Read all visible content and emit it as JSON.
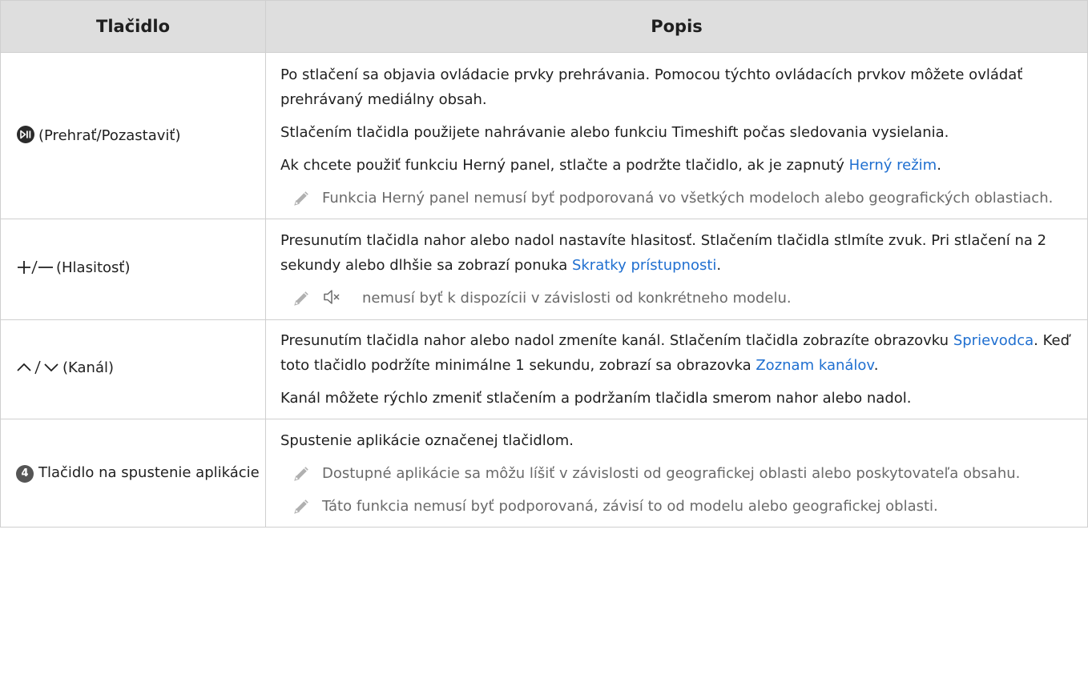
{
  "header": {
    "col_button": "Tlačidlo",
    "col_description": "Popis"
  },
  "rows": [
    {
      "button_label": "(Prehrať/Pozastaviť)",
      "icon": "play-pause-icon",
      "p1": "Po stlačení sa objavia ovládacie prvky prehrávania. Pomocou týchto ovládacích prvkov môžete ovládať prehrávaný mediálny obsah.",
      "p2": "Stlačením tlačidla použijete nahrávanie alebo funkciu Timeshift počas sledovania vysielania.",
      "p3_before": "Ak chcete použiť funkciu Herný panel, stlačte a podržte tlačidlo, ak je zapnutý ",
      "p3_link": "Herný režim",
      "p3_after": ".",
      "note": "Funkcia Herný panel nemusí byť podporovaná vo všetkých modeloch alebo geografických oblastiach."
    },
    {
      "button_label": "(Hlasitosť)",
      "icon": "plus-minus-icon",
      "p1_before": "Presunutím tlačidla nahor alebo nadol nastavíte hlasitosť. Stlačením tlačidla stlmíte zvuk. Pri stlačení na 2 sekundy alebo dlhšie sa zobrazí ponuka ",
      "p1_link": "Skratky prístupnosti",
      "p1_after": ".",
      "note_icon": "mute-icon",
      "note": "nemusí byť k dispozícii v závislosti od konkrétneho modelu."
    },
    {
      "button_label": "(Kanál)",
      "icon": "channel-up-down-icon",
      "p1_part1": "Presunutím tlačidla nahor alebo nadol zmeníte kanál. Stlačením tlačidla zobrazíte obrazovku ",
      "p1_link1": "Sprievodca",
      "p1_part2": ". Keď toto tlačidlo podržíte minimálne 1 sekundu, zobrazí sa obrazovka ",
      "p1_link2": "Zoznam kanálov",
      "p1_part3": ".",
      "p2": "Kanál môžete rýchlo zmeniť stlačením a podržaním tlačidla smerom nahor alebo nadol."
    },
    {
      "icon_number": "4",
      "button_label": "Tlačidlo na spustenie aplikácie",
      "p1": "Spustenie aplikácie označenej tlačidlom.",
      "note1": "Dostupné aplikácie sa môžu líšiť v závislosti od geografickej oblasti alebo poskytovateľa obsahu.",
      "note2": "Táto funkcia nemusí byť podporovaná, závisí to od modelu alebo geografickej oblasti."
    }
  ],
  "colors": {
    "header_bg": "#dedede",
    "link": "#1f6fd0",
    "note_text": "#6a6a6a",
    "border": "#cfcfcf"
  }
}
